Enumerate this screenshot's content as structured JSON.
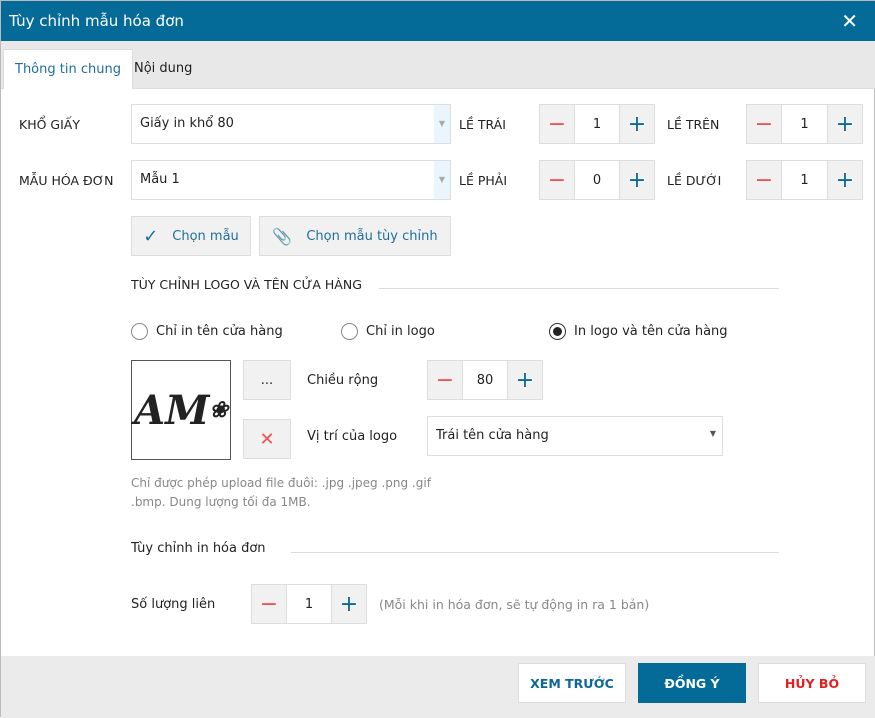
{
  "dialog": {
    "title": "Tùy chỉnh mẫu hóa đơn",
    "close": "✕"
  },
  "tabs": [
    {
      "label": "Thông tin chung"
    },
    {
      "label": "Nội dung"
    }
  ],
  "paper": {
    "label": "KHỔ GIẤY",
    "value": "Giấy in khổ 80"
  },
  "template": {
    "label": "MẪU HÓA ĐƠN",
    "value": "Mẫu 1"
  },
  "margins": {
    "left": {
      "label": "LỀ TRÁI",
      "value": "1"
    },
    "top": {
      "label": "LỀ TRÊN",
      "value": "1"
    },
    "right": {
      "label": "LỀ PHẢI",
      "value": "0"
    },
    "bottom": {
      "label": "LỀ DƯỚI",
      "value": "1"
    }
  },
  "buttons": {
    "choose_template": "Chọn mẫu",
    "choose_custom": "Chọn mẫu tùy chỉnh",
    "browse": "...",
    "remove": "✕"
  },
  "logo_section": {
    "title": "TÙY CHỈNH LOGO VÀ TÊN CỬA HÀNG",
    "options": [
      {
        "label": "Chỉ in tên cửa hàng",
        "selected": false
      },
      {
        "label": "Chỉ in logo",
        "selected": false
      },
      {
        "label": "In logo và tên cửa hàng",
        "selected": true
      }
    ],
    "logo_text": "AM",
    "width_label": "Chiều rộng",
    "width_value": "80",
    "position_label": "Vị trí của logo",
    "position_value": "Trái tên cửa hàng",
    "hint": "Chỉ được phép upload file đuôi: .jpg .jpeg .png .gif .bmp. Dung lượng tối đa 1MB."
  },
  "print_section": {
    "title": "Tùy chỉnh in hóa đơn",
    "copies_label": "Số lượng liên",
    "copies_value": "1",
    "copies_hint": "(Mỗi khi in hóa đơn, sẽ tự động in ra 1 bản)"
  },
  "footer": {
    "preview": "XEM TRƯỚC",
    "ok": "ĐỒNG Ý",
    "cancel": "HỦY BỎ"
  },
  "colors": {
    "primary": "#046b99",
    "danger": "#f05050"
  }
}
